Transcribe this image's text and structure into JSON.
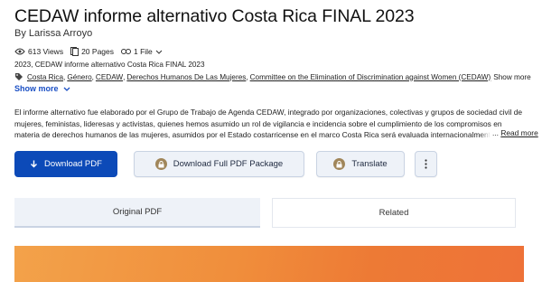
{
  "document": {
    "title": "CEDAW informe alternativo Costa Rica FINAL 2023",
    "author": "By Larissa Arroyo"
  },
  "stats": {
    "views": "613 Views",
    "pages": "20 Pages",
    "files": "1 File"
  },
  "subtitle_line": "2023, CEDAW informe alternativo Costa Rica FINAL 2023",
  "tags": [
    "Costa Rica",
    "Género",
    "CEDAW",
    "Derechos Humanos De Las Mujeres",
    "Committee on the Elimination of Discrimination against Women (CEDAW)"
  ],
  "tags_show_more": "Show more",
  "show_more": "Show more",
  "abstract": "El informe alternativo fue elaborado por el Grupo de Trabajo de Agenda CEDAW, integrado por organizaciones, colectivas y grupos de sociedad civil de mujeres, feministas, lideresas y activistas, quienes hemos asumido un rol de vigilancia e incidencia sobre el cumplimiento de los compromisos en materia de derechos humanos de las mujeres, asumidos por el Estado costarricense en el marco Costa Rica será evaluada internacionalmente en materia de derechos de",
  "read_more": {
    "ellipsis": "...",
    "label": "Read more"
  },
  "buttons": {
    "download_pdf": "Download PDF",
    "download_package": "Download Full PDF Package",
    "translate": "Translate"
  },
  "tabs": {
    "original": "Original PDF",
    "related": "Related"
  },
  "colors": {
    "primary": "#0c4ab8",
    "link": "#1a4fc4",
    "secondary_bg": "#eef2f8",
    "lock": "#a0865a",
    "preview_orange": "#f08d3b"
  }
}
